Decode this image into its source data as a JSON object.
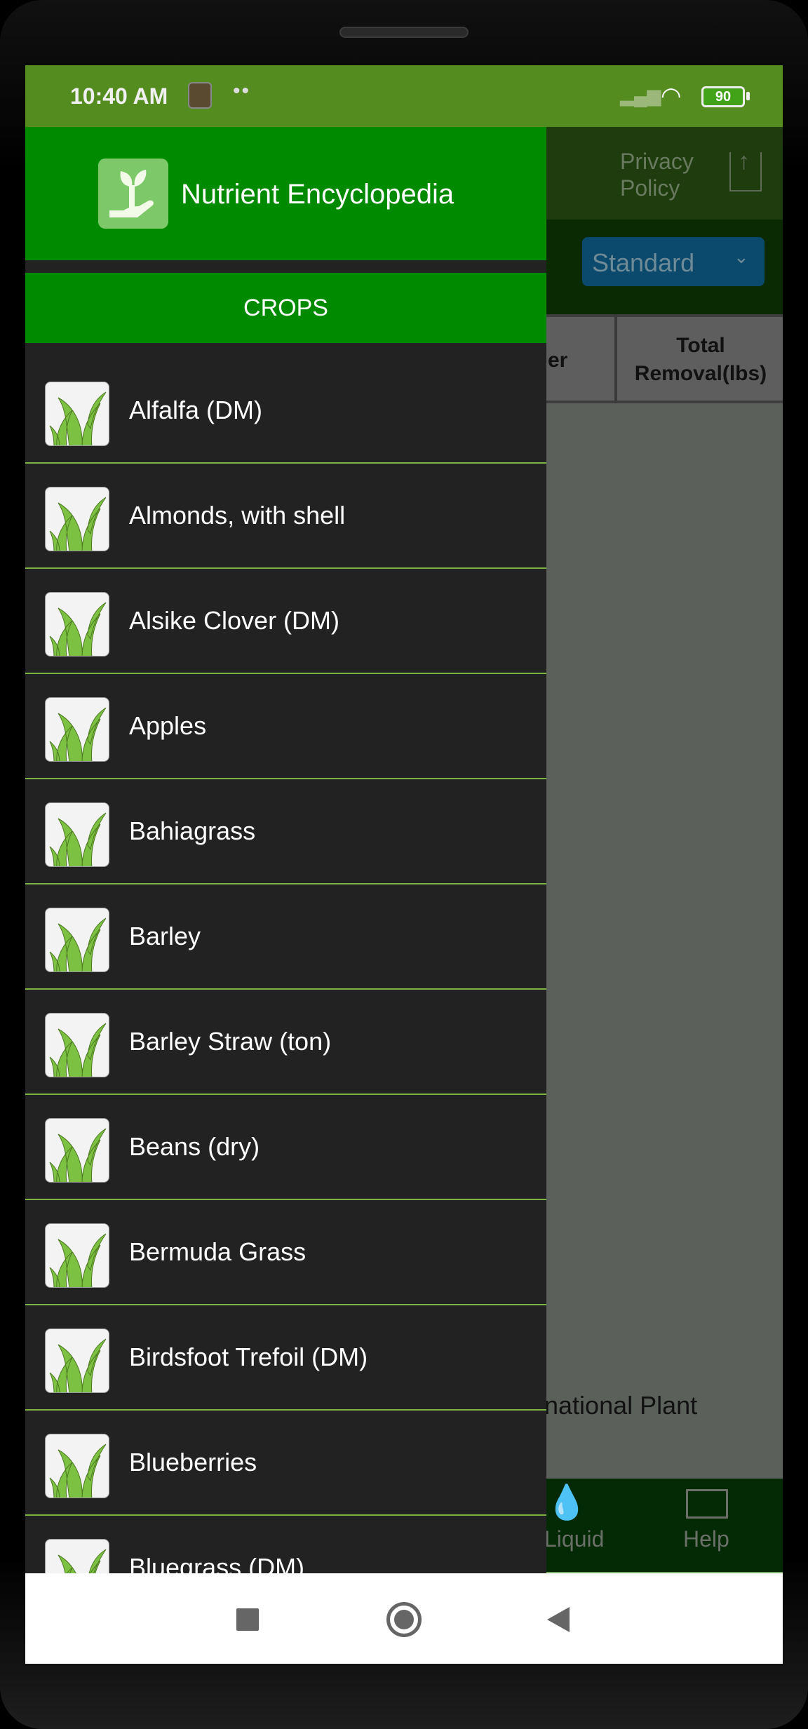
{
  "status_bar": {
    "time": "10:40 AM",
    "battery": "90",
    "notification_dots": "••"
  },
  "app": {
    "privacy_policy": "Privacy Policy",
    "unit_select": "Standard",
    "table_headers": [
      "er",
      "Total Removal(lbs)"
    ],
    "body_text_partial": "national Plant",
    "bottom_nav": [
      {
        "label": "Liquid",
        "icon": "liquid-drop-icon"
      },
      {
        "label": "Help",
        "icon": "presentation-board-icon"
      }
    ]
  },
  "drawer": {
    "title": "Nutrient Encyclopedia",
    "section": "CROPS",
    "items": [
      "Alfalfa (DM)",
      "Almonds, with shell",
      "Alsike Clover (DM)",
      "Apples",
      "Bahiagrass",
      "Barley",
      "Barley Straw (ton)",
      "Beans (dry)",
      "Bermuda Grass",
      "Birdsfoot Trefoil (DM)",
      "Blueberries",
      "Bluegrass (DM)"
    ]
  },
  "colors": {
    "drawer_header": "#008a00",
    "status_bar": "#548c20",
    "divider": "#7cb342"
  }
}
